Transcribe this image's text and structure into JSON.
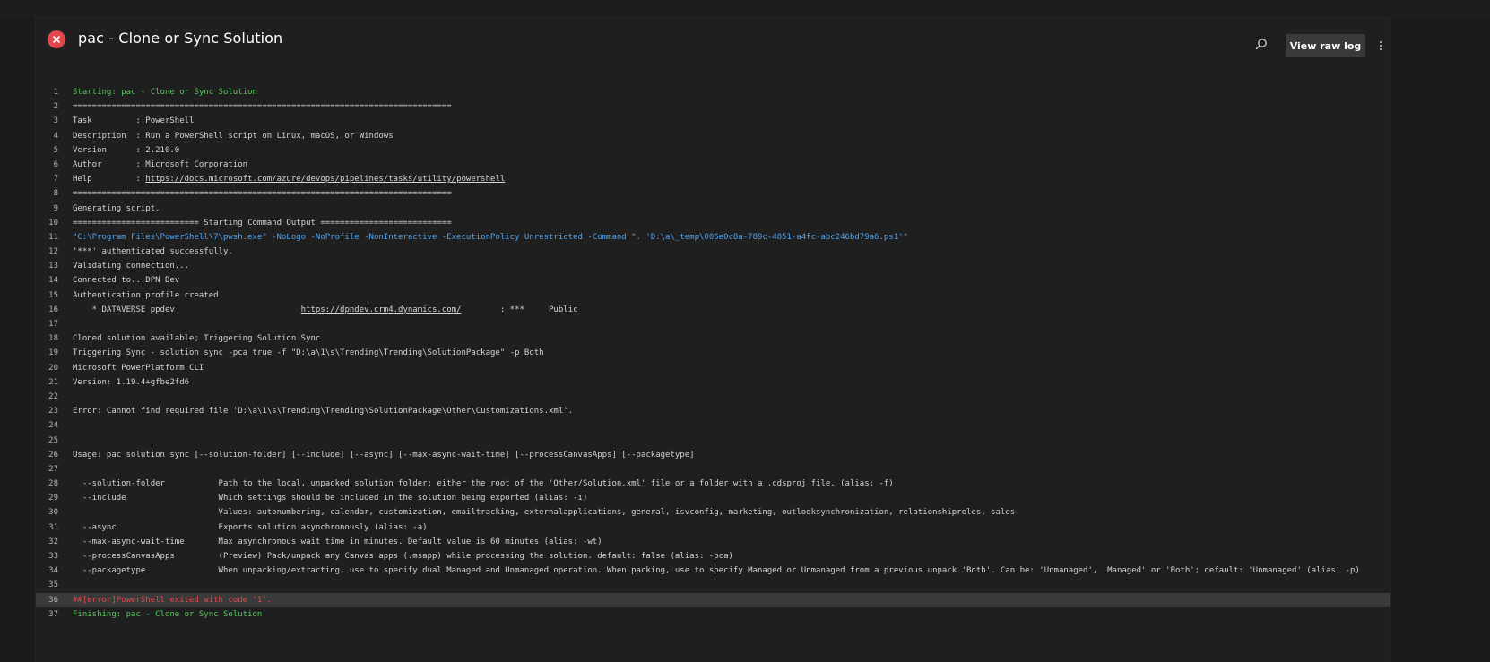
{
  "header": {
    "title": "pac - Clone or Sync Solution",
    "view_raw_log_label": "View raw log",
    "status": "failed"
  },
  "colors": {
    "error": "#e0474c",
    "success_text": "#57c75a",
    "command_text": "#4fa3f0",
    "error_text": "#e5484d",
    "highlight_row": "#3a3a3a"
  },
  "icons": {
    "status": "error-circle-icon",
    "search": "search-icon",
    "more": "more-vertical-icon"
  },
  "log": {
    "lines": [
      {
        "n": "1",
        "t": "Starting: pac - Clone or Sync Solution",
        "style": "green"
      },
      {
        "n": "2",
        "t": "==============================================================================",
        "style": ""
      },
      {
        "n": "3",
        "t": "Task         : PowerShell",
        "style": ""
      },
      {
        "n": "4",
        "t": "Description  : Run a PowerShell script on Linux, macOS, or Windows",
        "style": ""
      },
      {
        "n": "5",
        "t": "Version      : 2.210.0",
        "style": ""
      },
      {
        "n": "6",
        "t": "Author       : Microsoft Corporation",
        "style": ""
      },
      {
        "n": "7",
        "t": "Help         : ",
        "link": "https://docs.microsoft.com/azure/devops/pipelines/tasks/utility/powershell",
        "style": ""
      },
      {
        "n": "8",
        "t": "==============================================================================",
        "style": ""
      },
      {
        "n": "9",
        "t": "Generating script.",
        "style": ""
      },
      {
        "n": "10",
        "t": "========================== Starting Command Output ===========================",
        "style": ""
      },
      {
        "n": "11",
        "t": "\"C:\\Program Files\\PowerShell\\7\\pwsh.exe\" -NoLogo -NoProfile -NonInteractive -ExecutionPolicy Unrestricted -Command \". 'D:\\a\\_temp\\006e0c8a-789c-4851-a4fc-abc246bd79a6.ps1'\"",
        "style": "blue"
      },
      {
        "n": "12",
        "t": "'***' authenticated successfully.",
        "style": ""
      },
      {
        "n": "13",
        "t": "Validating connection...",
        "style": ""
      },
      {
        "n": "14",
        "t": "Connected to...DPN Dev",
        "style": ""
      },
      {
        "n": "15",
        "t": "Authentication profile created",
        "style": ""
      },
      {
        "n": "16",
        "t": "    * DATAVERSE ppdev                          ",
        "link": "https://dpndev.crm4.dynamics.com/",
        "after": "        : ***     Public",
        "style": ""
      },
      {
        "n": "17",
        "t": "",
        "style": ""
      },
      {
        "n": "18",
        "t": "Cloned solution available; Triggering Solution Sync",
        "style": ""
      },
      {
        "n": "19",
        "t": "Triggering Sync - solution sync -pca true -f \"D:\\a\\1\\s\\Trending\\Trending\\SolutionPackage\" -p Both",
        "style": ""
      },
      {
        "n": "20",
        "t": "Microsoft PowerPlatform CLI",
        "style": ""
      },
      {
        "n": "21",
        "t": "Version: 1.19.4+gfbe2fd6",
        "style": ""
      },
      {
        "n": "22",
        "t": "",
        "style": ""
      },
      {
        "n": "23",
        "t": "Error: Cannot find required file 'D:\\a\\1\\s\\Trending\\Trending\\SolutionPackage\\Other\\Customizations.xml'.",
        "style": ""
      },
      {
        "n": "24",
        "t": "",
        "style": ""
      },
      {
        "n": "25",
        "t": "",
        "style": ""
      },
      {
        "n": "26",
        "t": "Usage: pac solution sync [--solution-folder] [--include] [--async] [--max-async-wait-time] [--processCanvasApps] [--packagetype]",
        "style": ""
      },
      {
        "n": "27",
        "t": "",
        "style": ""
      },
      {
        "n": "28",
        "t": "  --solution-folder           Path to the local, unpacked solution folder: either the root of the 'Other/Solution.xml' file or a folder with a .cdsproj file. (alias: -f)",
        "style": ""
      },
      {
        "n": "29",
        "t": "  --include                   Which settings should be included in the solution being exported (alias: -i)",
        "style": ""
      },
      {
        "n": "30",
        "t": "                              Values: autonumbering, calendar, customization, emailtracking, externalapplications, general, isvconfig, marketing, outlooksynchronization, relationshiproles, sales",
        "style": ""
      },
      {
        "n": "31",
        "t": "  --async                     Exports solution asynchronously (alias: -a)",
        "style": ""
      },
      {
        "n": "32",
        "t": "  --max-async-wait-time       Max asynchronous wait time in minutes. Default value is 60 minutes (alias: -wt)",
        "style": ""
      },
      {
        "n": "33",
        "t": "  --processCanvasApps         (Preview) Pack/unpack any Canvas apps (.msapp) while processing the solution. default: false (alias: -pca)",
        "style": ""
      },
      {
        "n": "34",
        "t": "  --packagetype               When unpacking/extracting, use to specify dual Managed and Unmanaged operation. When packing, use to specify Managed or Unmanaged from a previous unpack 'Both'. Can be: 'Unmanaged', 'Managed' or 'Both'; default: 'Unmanaged' (alias: -p)",
        "style": ""
      },
      {
        "n": "35",
        "t": "",
        "style": ""
      },
      {
        "n": "36",
        "t": "##[error]PowerShell exited with code '1'.",
        "style": "red highlight"
      },
      {
        "n": "37",
        "t": "Finishing: pac - Clone or Sync Solution",
        "style": "green"
      }
    ]
  }
}
